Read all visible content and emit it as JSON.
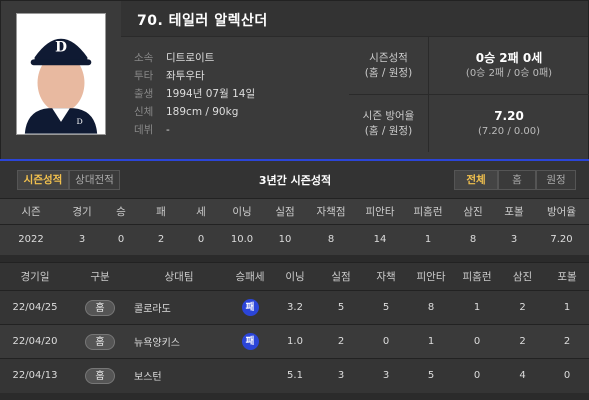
{
  "player": {
    "name": "70. 테일러 알렉산더",
    "info": [
      {
        "key": "소속",
        "value": "디트로이트"
      },
      {
        "key": "투타",
        "value": "좌투우타"
      },
      {
        "key": "출생",
        "value": "1994년 07월 14일"
      },
      {
        "key": "신체",
        "value": "189cm / 90kg"
      },
      {
        "key": "데뷔",
        "value": "-"
      }
    ]
  },
  "season_summary": {
    "record_label_1": "시즌성적",
    "record_label_2": "(홈 / 원정)",
    "record_main": "0승 2패 0세",
    "record_sub": "(0승 2패 / 0승 0패)",
    "era_label_1": "시즌 방어율",
    "era_label_2": "(홈 / 원정)",
    "era_main": "7.20",
    "era_sub": "(7.20 / 0.00)"
  },
  "tabs": {
    "season": "시즌성적",
    "opponent": "상대전적",
    "section_title": "3년간 시즌성적",
    "all": "전체",
    "home": "홈",
    "away": "원정"
  },
  "season_table": {
    "headers": [
      "시즌",
      "경기",
      "승",
      "패",
      "세",
      "이닝",
      "실점",
      "자책점",
      "피안타",
      "피홈런",
      "삼진",
      "포볼",
      "방어율"
    ],
    "rows": [
      [
        "2022",
        "3",
        "0",
        "2",
        "0",
        "10.0",
        "10",
        "8",
        "14",
        "1",
        "8",
        "3",
        "7.20"
      ]
    ]
  },
  "game_table": {
    "headers": [
      "경기일",
      "구분",
      "상대팀",
      "승패세",
      "이닝",
      "실점",
      "자책",
      "피안타",
      "피홈런",
      "삼진",
      "포볼"
    ],
    "rows": [
      {
        "date": "22/04/25",
        "type": "홈",
        "opponent": "콜로라도",
        "result": "패",
        "ip": "3.2",
        "r": "5",
        "er": "5",
        "h": "8",
        "hr": "1",
        "so": "2",
        "bb": "1"
      },
      {
        "date": "22/04/20",
        "type": "홈",
        "opponent": "뉴욕양키스",
        "result": "패",
        "ip": "1.0",
        "r": "2",
        "er": "0",
        "h": "1",
        "hr": "0",
        "so": "2",
        "bb": "2"
      },
      {
        "date": "22/04/13",
        "type": "홈",
        "opponent": "보스턴",
        "result": "",
        "ip": "5.1",
        "r": "3",
        "er": "3",
        "h": "5",
        "hr": "0",
        "so": "4",
        "bb": "0"
      }
    ]
  },
  "colors": {
    "accent": "#2b45d8",
    "active_tab": "#f2c14e"
  },
  "icons": {
    "player_photo": "player-portrait-image",
    "loss_badge": "loss-circle-badge"
  }
}
